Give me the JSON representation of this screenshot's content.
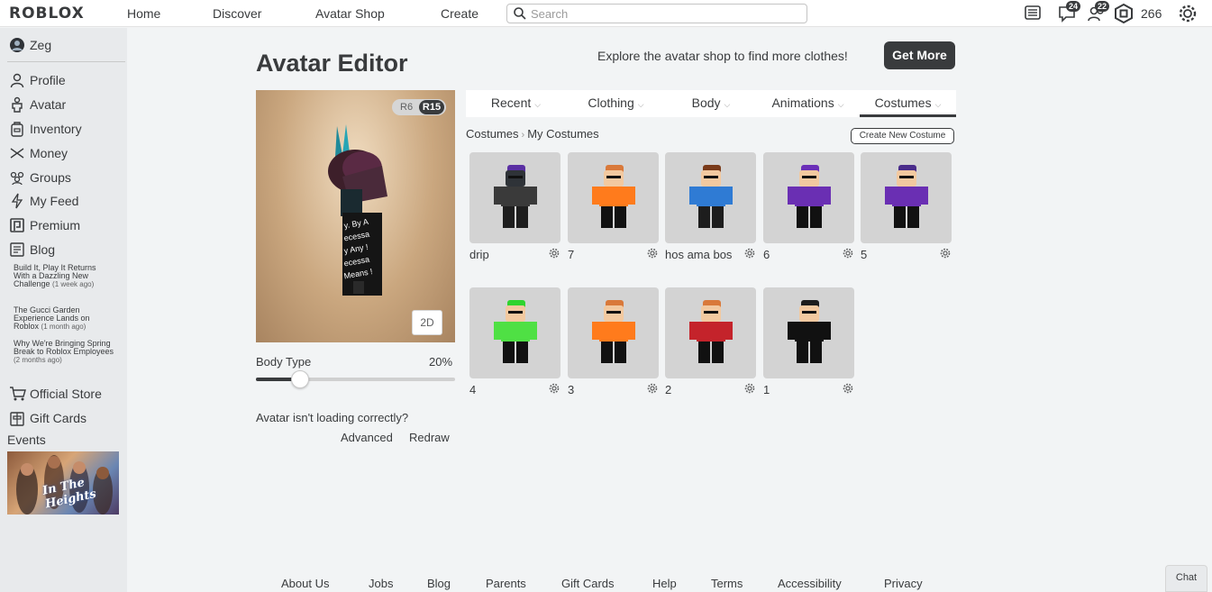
{
  "topbar": {
    "logo": "ROBLOX",
    "nav": [
      "Home",
      "Discover",
      "Avatar Shop",
      "Create"
    ],
    "search_placeholder": "Search",
    "messages_badge": "24",
    "friends_badge": "22",
    "robux": "266"
  },
  "sidebar": {
    "username": "Zeg",
    "items": [
      "Profile",
      "Avatar",
      "Inventory",
      "Money",
      "Groups",
      "My Feed",
      "Premium",
      "Blog"
    ],
    "blog_posts": [
      {
        "title": "Build It, Play It Returns With a Dazzling New Challenge",
        "ago": "(1 week ago)"
      },
      {
        "title": "The Gucci Garden Experience Lands on Roblox",
        "ago": "(1 month ago)"
      },
      {
        "title": "Why We're Bringing Spring Break to Roblox Employees",
        "ago": "(2 months ago)"
      }
    ],
    "bottom_items": [
      "Official Store",
      "Gift Cards"
    ],
    "events_label": "Events",
    "event_banner_text": "In The Heights"
  },
  "main": {
    "title": "Avatar Editor",
    "promo": "Explore the avatar shop to find more clothes!",
    "get_more": "Get More",
    "rig_r6": "R6",
    "rig_r15": "R15",
    "btn_2d": "2D",
    "body_type_label": "Body Type",
    "body_type_value": "20%",
    "body_type_fraction": 0.2,
    "not_loading": "Avatar isn't loading correctly?",
    "advanced": "Advanced",
    "redraw": "Redraw"
  },
  "tabs": [
    {
      "label": "Recent",
      "active": false
    },
    {
      "label": "Clothing",
      "active": false
    },
    {
      "label": "Body",
      "active": false
    },
    {
      "label": "Animations",
      "active": false
    },
    {
      "label": "Costumes",
      "active": true
    }
  ],
  "breadcrumb": {
    "root": "Costumes",
    "current": "My Costumes"
  },
  "create_costume": "Create New Costume",
  "costumes": [
    {
      "name": "drip",
      "skin": "#2f3338",
      "shirt": "#3a3a3a",
      "pants": "#1e1e1e",
      "hair": "#5a2fa3"
    },
    {
      "name": "7",
      "skin": "#f2c9a0",
      "shirt": "#ff7b1c",
      "pants": "#111111",
      "hair": "#d9793a"
    },
    {
      "name": "hos ama bos",
      "skin": "#f2c9a0",
      "shirt": "#2f7bd4",
      "pants": "#1d1d1d",
      "hair": "#7a3b1a"
    },
    {
      "name": "6",
      "skin": "#f2c9a0",
      "shirt": "#6a2fb3",
      "pants": "#111111",
      "hair": "#6b2fb8"
    },
    {
      "name": "5",
      "skin": "#f2c9a0",
      "shirt": "#6a2fb3",
      "pants": "#111111",
      "hair": "#4a2c8a"
    },
    {
      "name": "4",
      "skin": "#f2c9a0",
      "shirt": "#4fe044",
      "pants": "#111111",
      "hair": "#2fd42f"
    },
    {
      "name": "3",
      "skin": "#f2c9a0",
      "shirt": "#ff7b1c",
      "pants": "#111111",
      "hair": "#d9793a"
    },
    {
      "name": "2",
      "skin": "#f2c9a0",
      "shirt": "#c4232b",
      "pants": "#111111",
      "hair": "#d9793a"
    },
    {
      "name": "1",
      "skin": "#f2c9a0",
      "shirt": "#111111",
      "pants": "#111111",
      "hair": "#1d1d1d"
    }
  ],
  "footer": [
    "About Us",
    "Jobs",
    "Blog",
    "Parents",
    "Gift Cards",
    "Help",
    "Terms",
    "Accessibility",
    "Privacy"
  ],
  "chat": "Chat"
}
